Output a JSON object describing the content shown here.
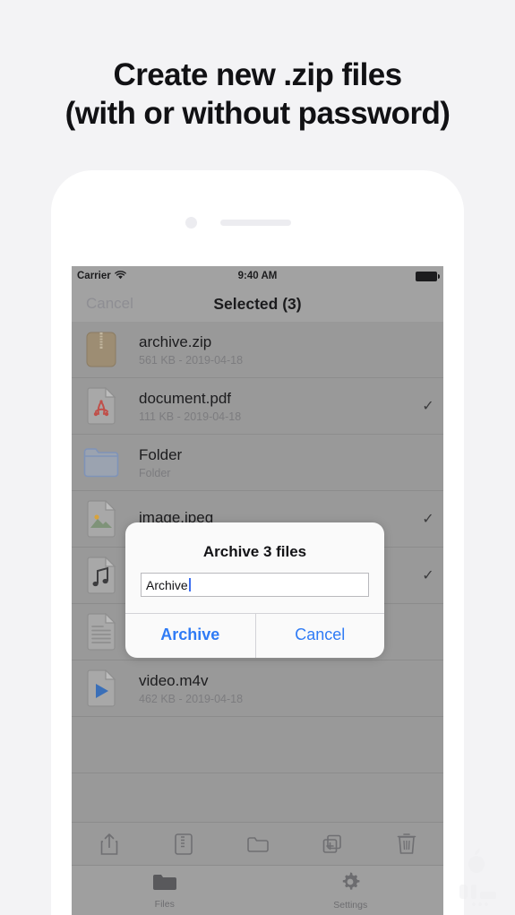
{
  "headline": {
    "line1": "Create new .zip files",
    "line2": "(with or without password)"
  },
  "colors": {
    "page_background": "#f3f3f5",
    "screen_background": "#999999",
    "accent_blue": "#2f7bf5",
    "caret_blue": "#3c6ef0",
    "pdf_red": "#c0504a",
    "zip_tan": "#9d8d73",
    "folder_blue": "#7f93b8"
  },
  "status_bar": {
    "carrier": "Carrier",
    "wifi_icon": "wifi-icon",
    "time": "9:40 AM",
    "battery_icon": "battery-full-icon"
  },
  "nav_bar": {
    "cancel_label": "Cancel",
    "title": "Selected (3)"
  },
  "files": [
    {
      "name": "archive.zip",
      "detail": "561 KB - 2019-04-18",
      "icon": "zip-file-icon",
      "selected": false
    },
    {
      "name": "document.pdf",
      "detail": "111 KB - 2019-04-18",
      "icon": "pdf-file-icon",
      "selected": true
    },
    {
      "name": "Folder",
      "detail": "Folder",
      "icon": "folder-icon",
      "selected": false
    },
    {
      "name": "image.jpeg",
      "detail": "",
      "icon": "image-file-icon",
      "selected": true
    },
    {
      "name": "",
      "detail": "",
      "icon": "audio-file-icon",
      "selected": true
    },
    {
      "name": "",
      "detail": "",
      "icon": "text-file-icon",
      "selected": false
    },
    {
      "name": "video.m4v",
      "detail": "462 KB - 2019-04-18",
      "icon": "video-file-icon",
      "selected": false
    }
  ],
  "dialog": {
    "title": "Archive 3 files",
    "field_value": "Archive",
    "confirm_label": "Archive",
    "cancel_label": "Cancel"
  },
  "toolbar": {
    "items": [
      {
        "icon": "share-icon"
      },
      {
        "icon": "zip-compress-icon"
      },
      {
        "icon": "new-folder-icon"
      },
      {
        "icon": "duplicate-icon"
      },
      {
        "icon": "trash-icon"
      }
    ]
  },
  "tab_bar": {
    "tabs": [
      {
        "label": "Files",
        "icon": "folder-tab-icon"
      },
      {
        "label": "Settings",
        "icon": "gear-tab-icon"
      }
    ]
  }
}
